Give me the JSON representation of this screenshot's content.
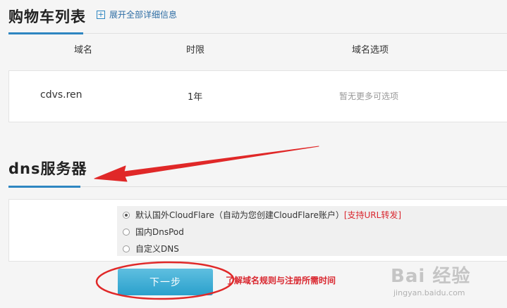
{
  "cart": {
    "title": "购物车列表",
    "expand_label": "展开全部详细信息",
    "columns": [
      "域名",
      "时限",
      "域名选项"
    ],
    "rows": [
      {
        "domain": "cdvs.ren",
        "period": "1年",
        "options": "暂无更多可选项"
      }
    ]
  },
  "dns": {
    "title": "dns服务器",
    "options": [
      {
        "label": "默认国外CloudFlare（自动为您创建CloudFlare账户）",
        "tag": "[支持URL转发]",
        "checked": true
      },
      {
        "label": "国内DnsPod",
        "checked": false
      },
      {
        "label": "自定义DNS",
        "checked": false
      }
    ]
  },
  "actions": {
    "next_label": "下一步",
    "rules_link": "了解域名规则与注册所需时间"
  },
  "watermark": {
    "logo": "Bai 经验",
    "url": "jingyan.baidu.com"
  },
  "colors": {
    "accent": "#2e86c1",
    "button": "#2aa0cc",
    "annotation_red": "#e02828",
    "link_red": "#d9262e"
  }
}
